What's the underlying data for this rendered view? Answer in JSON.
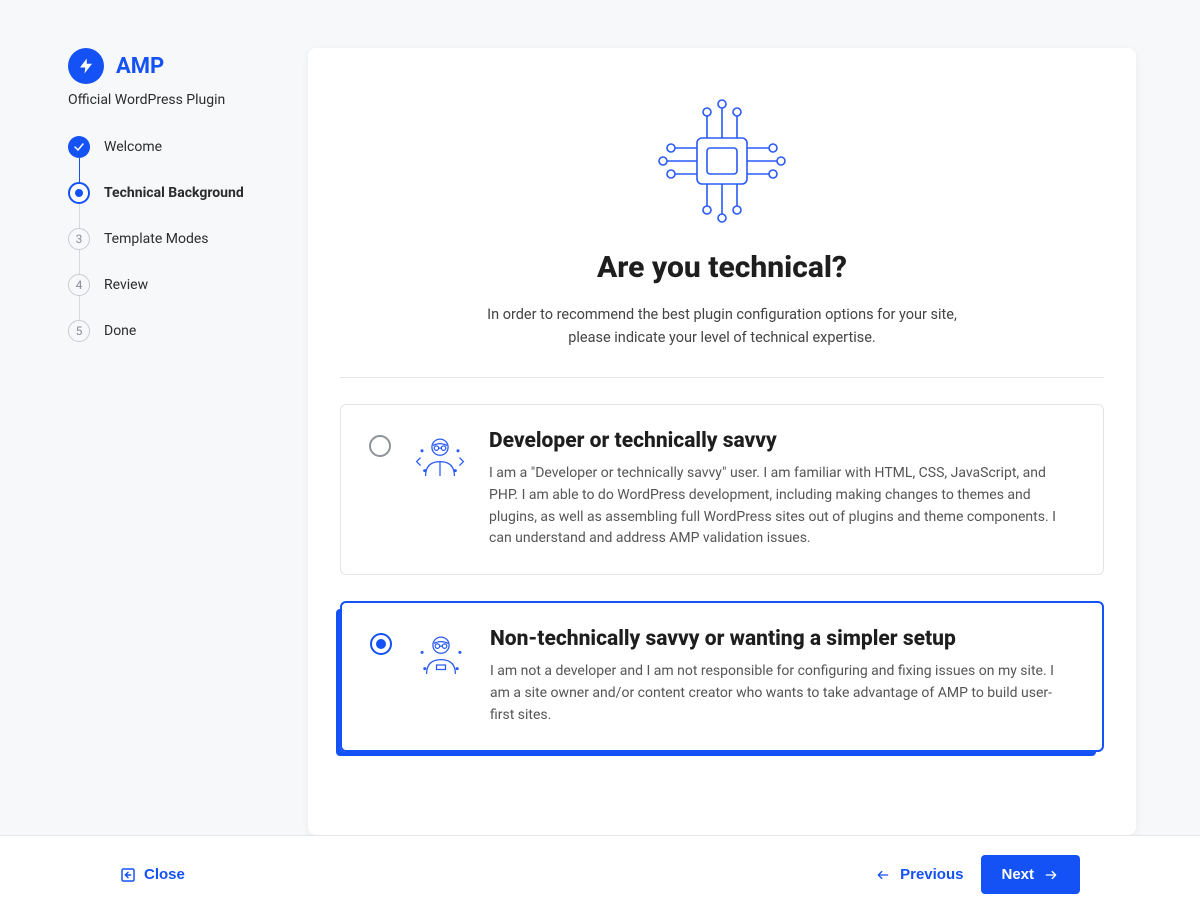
{
  "brand": "AMP",
  "subtitle": "Official WordPress Plugin",
  "steps": [
    {
      "label": "Welcome",
      "state": "done"
    },
    {
      "label": "Technical Background",
      "state": "active"
    },
    {
      "label": "Template Modes",
      "state": "pending",
      "num": "3"
    },
    {
      "label": "Review",
      "state": "pending",
      "num": "4"
    },
    {
      "label": "Done",
      "state": "pending",
      "num": "5"
    }
  ],
  "heading": "Are you technical?",
  "intro_line1": "In order to recommend the best plugin configuration options for your site,",
  "intro_line2": "please indicate your level of technical expertise.",
  "options": [
    {
      "title": "Developer or technically savvy",
      "desc": "I am a \"Developer or technically savvy\" user. I am familiar with HTML, CSS, JavaScript, and PHP. I am able to do WordPress development, including making changes to themes and plugins, as well as assembling full WordPress sites out of plugins and theme components. I can understand and address AMP validation issues.",
      "selected": false
    },
    {
      "title": "Non-technically savvy or wanting a simpler setup",
      "desc": "I am not a developer and I am not responsible for configuring and fixing issues on my site. I am a site owner and/or content creator who wants to take advantage of AMP to build user-first sites.",
      "selected": true
    }
  ],
  "footer": {
    "close": "Close",
    "prev": "Previous",
    "next": "Next"
  },
  "colors": {
    "accent": "#1452f5"
  }
}
